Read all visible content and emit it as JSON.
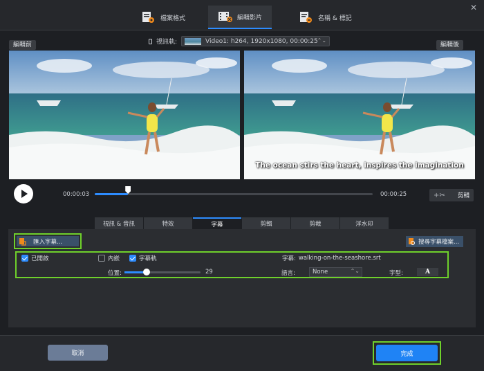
{
  "top_tabs": [
    {
      "label": "檔案格式",
      "icon": "file-format-icon"
    },
    {
      "label": "編輯影片",
      "icon": "edit-video-icon"
    },
    {
      "label": "名稱 & 標記",
      "icon": "name-tag-icon"
    }
  ],
  "preview": {
    "before_label": "編輯前",
    "after_label": "編輯後",
    "track_label": "視訊軌:",
    "track_value": "Video1: h264, 1920x1080, 00:00:25",
    "subtitle_overlay": "The ocean stirs the heart, inspires the imagination"
  },
  "playback": {
    "current_time": "00:00:03",
    "total_time": "00:00:25",
    "progress": 0.12,
    "cut_label": "剪輯"
  },
  "sub_tabs": [
    "視訊 & 音訊",
    "特效",
    "字幕",
    "剪輯",
    "剪裁",
    "浮水印"
  ],
  "active_sub_tab": "字幕",
  "subtitle_panel": {
    "import_label": "匯入字幕...",
    "search_label": "搜尋字幕檔案...",
    "enabled_label": "已開啟",
    "enabled_checked": true,
    "embedded_label": "內嵌",
    "embedded_checked": false,
    "track_label": "字幕軌",
    "track_checked": true,
    "subtitle_file_label": "字幕:",
    "subtitle_file": "walking-on-the-seashore.srt",
    "position_label": "位置:",
    "position_value": "29",
    "position_fraction": 0.29,
    "language_label": "語言:",
    "language_value": "None",
    "font_label": "字型:",
    "font_button": "A"
  },
  "footer": {
    "cancel_label": "取消",
    "done_label": "完成"
  },
  "colors": {
    "accent": "#2d8cff",
    "highlight": "#6fd12b",
    "background": "#1d1f23"
  }
}
